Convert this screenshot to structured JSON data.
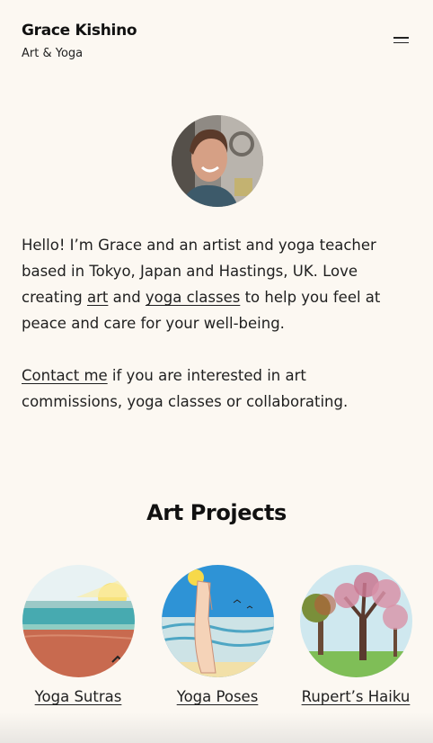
{
  "header": {
    "title": "Grace Kishino",
    "tagline": "Art & Yoga",
    "menu_icon": "hamburger-icon"
  },
  "intro": {
    "p1_part1": "Hello! I’m Grace and an artist and yoga teacher based in Tokyo, Japan and Hastings, UK. Love creating ",
    "link_art": "art",
    "p1_part2": " and ",
    "link_yoga": "yoga classes",
    "p1_part3": " to help you feel at peace and care for your well-being.",
    "link_contact": "Contact me",
    "p2_part": " if you are interested in art commissions, yoga classes or collaborating."
  },
  "projects": {
    "title": "Art Projects",
    "items": [
      {
        "label": "Yoga Sutras"
      },
      {
        "label": "Yoga Poses"
      },
      {
        "label": "Rupert’s Haiku"
      }
    ]
  },
  "colors": {
    "background": "#fcf8f2",
    "text": "#1f1f1f"
  }
}
